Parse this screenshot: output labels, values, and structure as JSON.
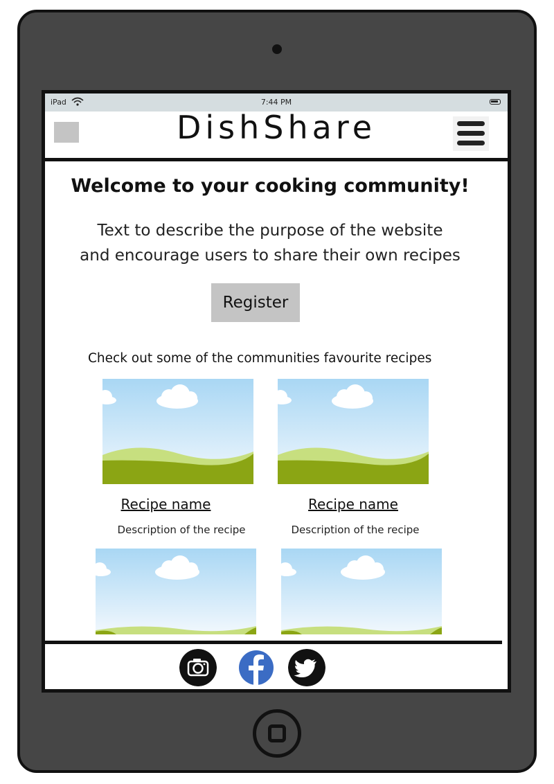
{
  "status_bar": {
    "device": "iPad",
    "time": "7:44 PM"
  },
  "header": {
    "brand": "DishShare",
    "menu_icon": "hamburger-menu-icon"
  },
  "hero": {
    "title": "Welcome to your cooking community!",
    "intro_line1": "Text to describe the purpose of the website",
    "intro_line2": "and encourage users to share their own recipes",
    "register_label": "Register"
  },
  "favourites": {
    "heading": "Check out some of the communities favourite recipes",
    "cards": [
      {
        "name": "Recipe name",
        "description": "Description of the recipe"
      },
      {
        "name": "Recipe name",
        "description": "Description of the recipe"
      },
      {
        "name": "",
        "description": ""
      },
      {
        "name": "",
        "description": ""
      }
    ]
  },
  "footer": {
    "icons": [
      "instagram-camera-icon",
      "facebook-icon",
      "twitter-icon"
    ]
  },
  "colors": {
    "placeholder_gray": "#c4c4c4",
    "facebook_blue": "#3b6cc4",
    "tablet_frame": "#464646",
    "grass": "#8ba514",
    "sky": "#cfe8f7"
  }
}
